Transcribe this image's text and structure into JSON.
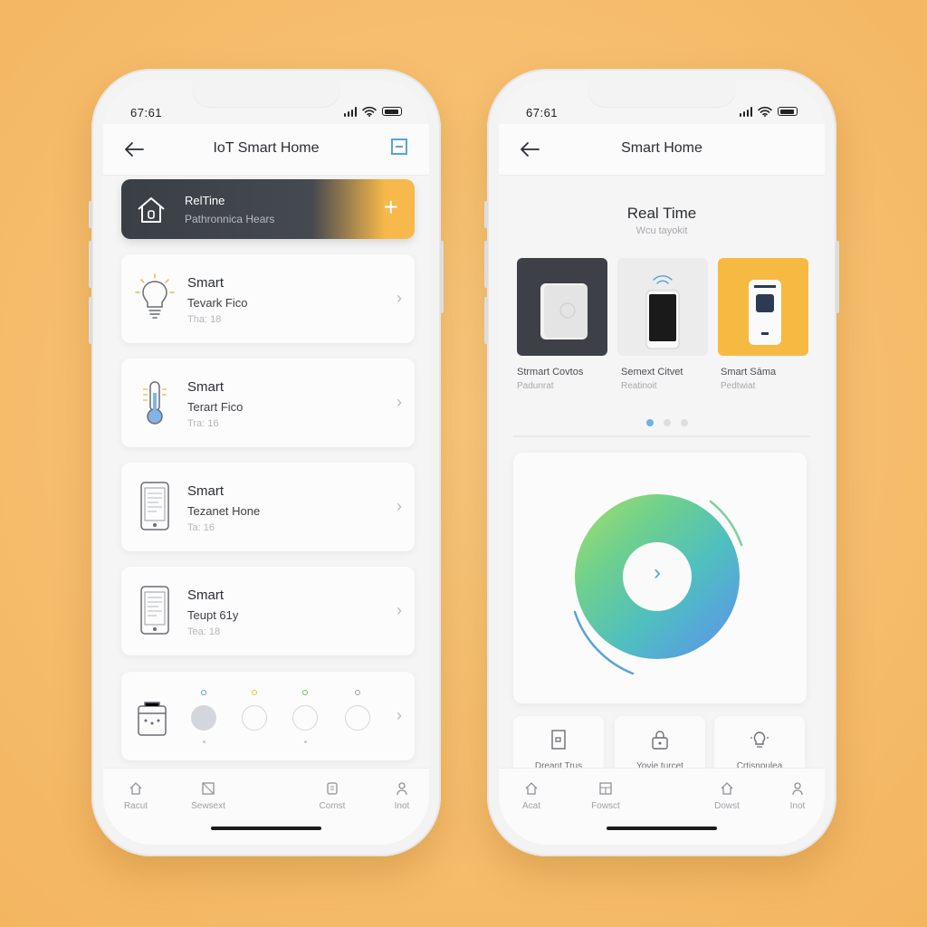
{
  "left_phone": {
    "status_time": "67:61",
    "header": {
      "title": "IoT Smart Home",
      "back_icon": "arrow-left-icon",
      "menu_icon": "minus-square-icon"
    },
    "banner": {
      "title": "RelTine",
      "subtitle": "Pathronnica Hears",
      "action": "+"
    },
    "cards": [
      {
        "title": "Smart",
        "subtitle": "Tevark Fico",
        "meta": "Tha:  18",
        "icon": "lightbulb-icon"
      },
      {
        "title": "Smart",
        "subtitle": "Terart Fico",
        "meta": "Tra:  16",
        "icon": "thermometer-icon"
      },
      {
        "title": "Smart",
        "subtitle": "Tezanet Hone",
        "meta": "Ta: 16",
        "icon": "phone-device-icon"
      },
      {
        "title": "Smart",
        "subtitle": "Teupt 61y",
        "meta": "Tea:  18",
        "icon": "phone-device-icon"
      }
    ],
    "swatch_colors": [
      "#5a9ed6",
      "#e2c23c",
      "#6bc24a",
      "#9aa0a8"
    ],
    "tabs": [
      "Racut",
      "Sewsext",
      "Comst",
      "Inot"
    ]
  },
  "right_phone": {
    "status_time": "67:61",
    "header": {
      "title": "Smart Home",
      "back_icon": "arrow-left-icon"
    },
    "section": {
      "title": "Real Time",
      "subtitle": "Wcu tayokit"
    },
    "devices": [
      {
        "name": "Strmart Covtos",
        "sub": "Padunrat",
        "bg": "#3d4047"
      },
      {
        "name": "Semext Citvet",
        "sub": "Reatinoit",
        "bg": "#ececec"
      },
      {
        "name": "Smart Sāma",
        "sub": "Pedtwiat",
        "bg": "#f6b942"
      }
    ],
    "active_page": 1,
    "dial_icon": "chevron-right-icon",
    "tiles": [
      {
        "label": "Dreant Trus",
        "icon": "door-icon"
      },
      {
        "label": "Yovie turcet",
        "icon": "lock-icon"
      },
      {
        "label": "Crtisnpulea",
        "icon": "lightbulb-icon"
      }
    ],
    "tabs": [
      "Acat",
      "Fowsct",
      "Dowst",
      "Inot"
    ]
  }
}
